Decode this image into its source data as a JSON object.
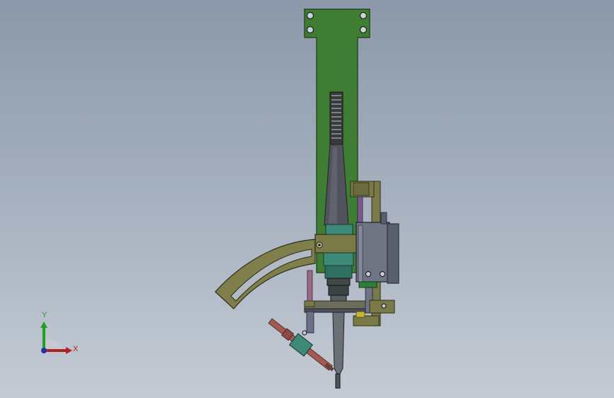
{
  "viewport": {
    "background_top": "#8c98a9",
    "background_bottom": "#c4cbd4"
  },
  "model": {
    "plate_color": "#3f7d35",
    "metal_color": "#6e6e40",
    "motor_color": "#50505a",
    "spindle_color": "#3d8a78",
    "cylinder_color": "#6f7482",
    "pin_color": "#a35a52"
  },
  "triad": {
    "x_label": "X",
    "y_label": "Y",
    "x_color": "#b02020",
    "y_color": "#22a022"
  }
}
